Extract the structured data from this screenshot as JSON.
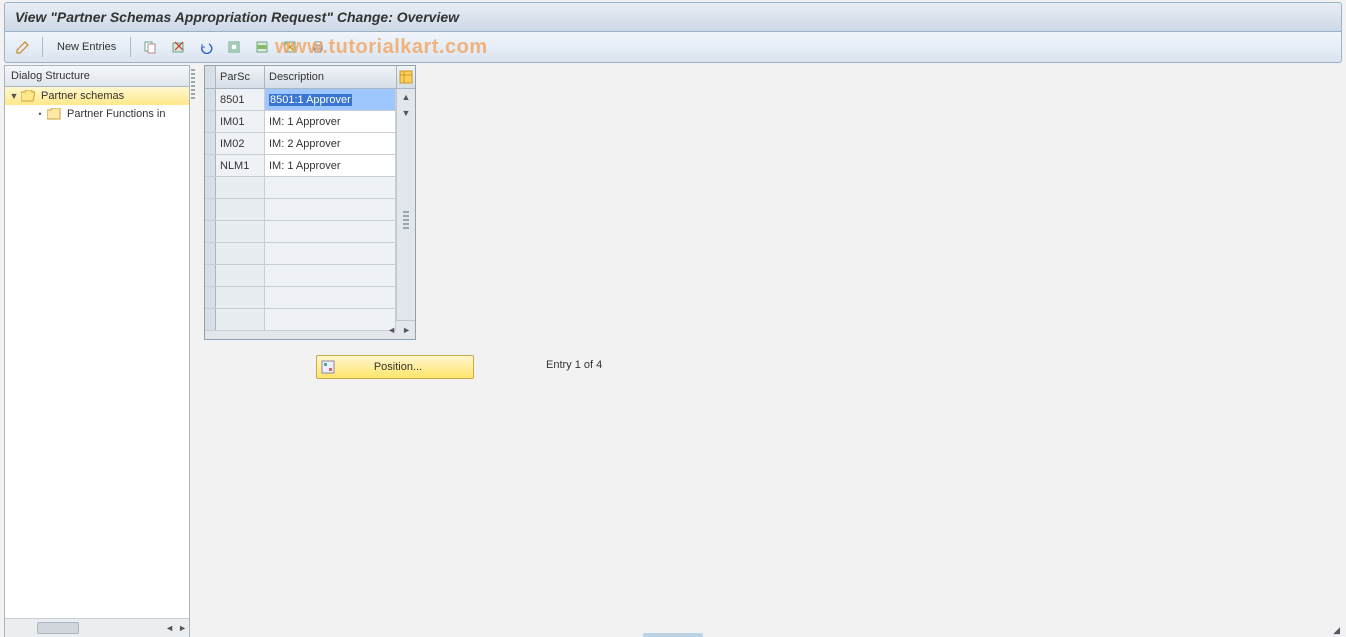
{
  "title": "View \"Partner Schemas Appropriation Request\" Change: Overview",
  "watermark": "www.tutorialkart.com",
  "toolbar": {
    "new_entries_label": "New Entries"
  },
  "tree": {
    "header": "Dialog Structure",
    "root": {
      "label": "Partner schemas",
      "expanded": true
    },
    "child": {
      "label": "Partner Functions in"
    }
  },
  "table": {
    "columns": {
      "parsc": "ParSc",
      "desc": "Description"
    },
    "rows": [
      {
        "parsc": "8501",
        "desc": "8501:1 Approver",
        "selected": true
      },
      {
        "parsc": "IM01",
        "desc": "IM: 1 Approver",
        "selected": false
      },
      {
        "parsc": "IM02",
        "desc": "IM: 2 Approver",
        "selected": false
      },
      {
        "parsc": "NLM1",
        "desc": "IM: 1 Approver",
        "selected": false
      }
    ],
    "empty_rows": 7
  },
  "position_button": "Position...",
  "entry_text": "Entry 1 of 4"
}
